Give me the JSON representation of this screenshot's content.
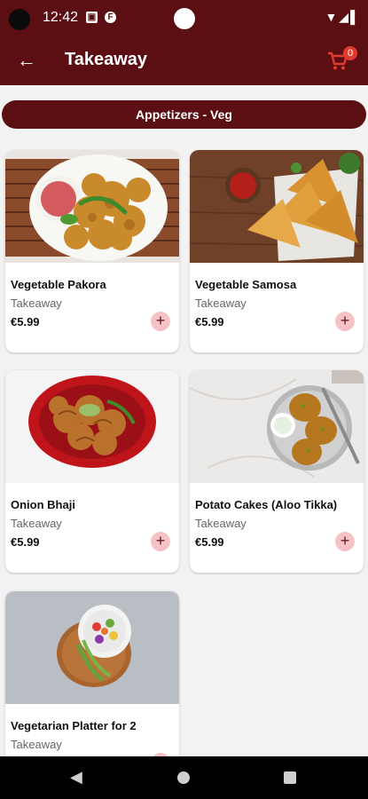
{
  "status_bar": {
    "time": "12:42",
    "icons": [
      "camera-dot-icon",
      "notification-icon",
      "notification-icon-2",
      "wifi-icon",
      "signal-icon",
      "battery-icon"
    ],
    "notif_1": "▣",
    "notif_2": "F",
    "right_icons": "▼◢▌"
  },
  "app_bar": {
    "title": "Takeaway",
    "back_glyph": "←",
    "cart_glyph": "🛒",
    "cart_count": "0"
  },
  "category": {
    "label": "Appetizers - Veg"
  },
  "items": [
    {
      "title": "Vegetable Pakora",
      "subtitle": "Takeaway",
      "price": "€5.99",
      "add": "+"
    },
    {
      "title": "Vegetable Samosa",
      "subtitle": "Takeaway",
      "price": "€5.99",
      "add": "+"
    },
    {
      "title": "Onion Bhaji",
      "subtitle": "Takeaway",
      "price": "€5.99",
      "add": "+"
    },
    {
      "title": "Potato Cakes (Aloo Tikka)",
      "subtitle": "Takeaway",
      "price": "€5.99",
      "add": "+"
    },
    {
      "title": "Vegetarian Platter for 2",
      "subtitle": "Takeaway",
      "price": "",
      "add": "+"
    }
  ],
  "nav_bar": {
    "back_glyph": "◀"
  },
  "colors": {
    "brand": "#5c0f13",
    "accent": "#e23a2e",
    "add_button": "#f3c3c5",
    "background": "#f2f2f2"
  }
}
